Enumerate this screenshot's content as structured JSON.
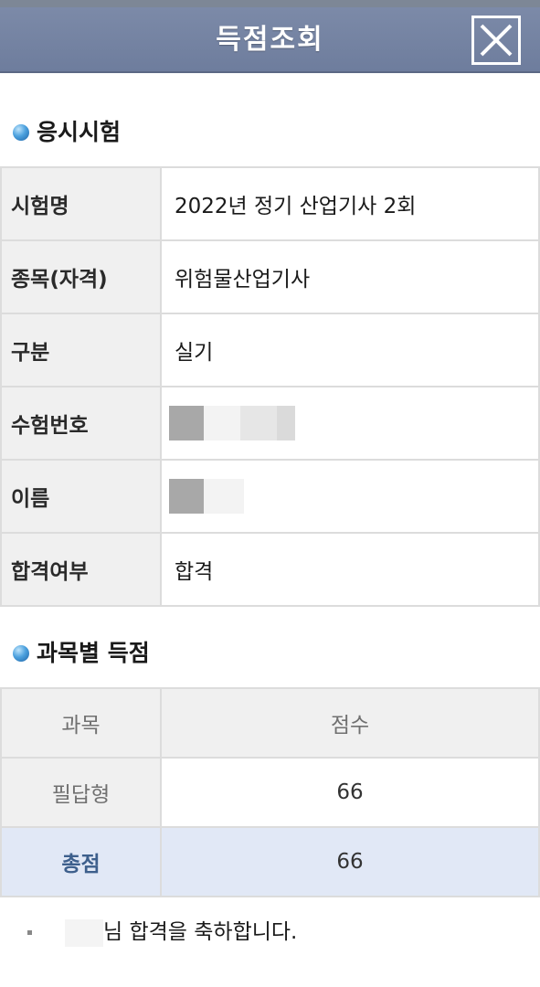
{
  "header": {
    "title": "득점조회",
    "close_icon": "close-icon"
  },
  "exam_section": {
    "title": "응시시험",
    "rows": [
      {
        "label": "시험명",
        "value": "2022년 정기 산업기사 2회"
      },
      {
        "label": "종목(자격)",
        "value": "위험물산업기사"
      },
      {
        "label": "구분",
        "value": "실기"
      },
      {
        "label": "수험번호",
        "value": ""
      },
      {
        "label": "이름",
        "value": ""
      },
      {
        "label": "합격여부",
        "value": "합격"
      }
    ]
  },
  "score_section": {
    "title": "과목별 득점",
    "headers": {
      "subject": "과목",
      "score": "점수"
    },
    "rows": [
      {
        "subject": "필답형",
        "score": "66"
      }
    ],
    "total": {
      "label": "총점",
      "score": "66"
    }
  },
  "message": {
    "text": "님 합격을 축하합니다."
  },
  "colors": {
    "header_bg": "#7282a2",
    "total_row_bg": "#e1e8f6",
    "total_label": "#3d5f8c",
    "bullet": "#3a8fd4"
  }
}
